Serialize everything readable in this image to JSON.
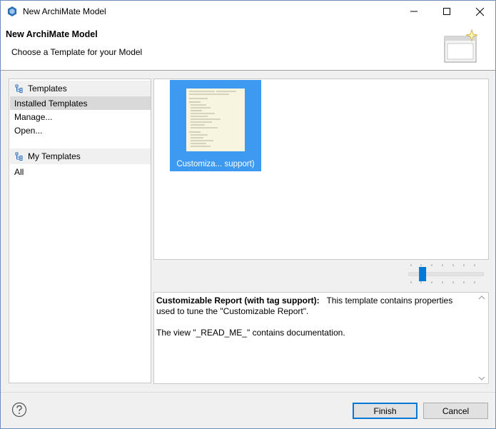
{
  "window": {
    "title": "New ArchiMate Model"
  },
  "banner": {
    "title": "New ArchiMate Model",
    "subtitle": "Choose a Template for your Model"
  },
  "sidebar": {
    "groups": [
      {
        "label": "Templates",
        "icon": "tree-icon",
        "items": [
          {
            "label": "Installed Templates",
            "selected": true
          },
          {
            "label": "Manage...",
            "selected": false
          },
          {
            "label": "Open...",
            "selected": false
          }
        ]
      },
      {
        "label": "My Templates",
        "icon": "tree-icon",
        "items": [
          {
            "label": "All",
            "selected": false
          }
        ]
      }
    ]
  },
  "gallery": {
    "templates": [
      {
        "label": "Customiza... support)",
        "selected": true
      }
    ]
  },
  "description": {
    "title": "Customizable Report (with tag support):",
    "line1": "This template contains properties used to tune the \"Customizable Report\".",
    "line2": "The view \"_READ_ME_\" contains documentation."
  },
  "zoom_slider": {
    "level": 0.15
  },
  "buttons": {
    "finish": "Finish",
    "cancel": "Cancel"
  },
  "colors": {
    "selection": "#3d9af0",
    "default_button_border": "#0078d7"
  }
}
